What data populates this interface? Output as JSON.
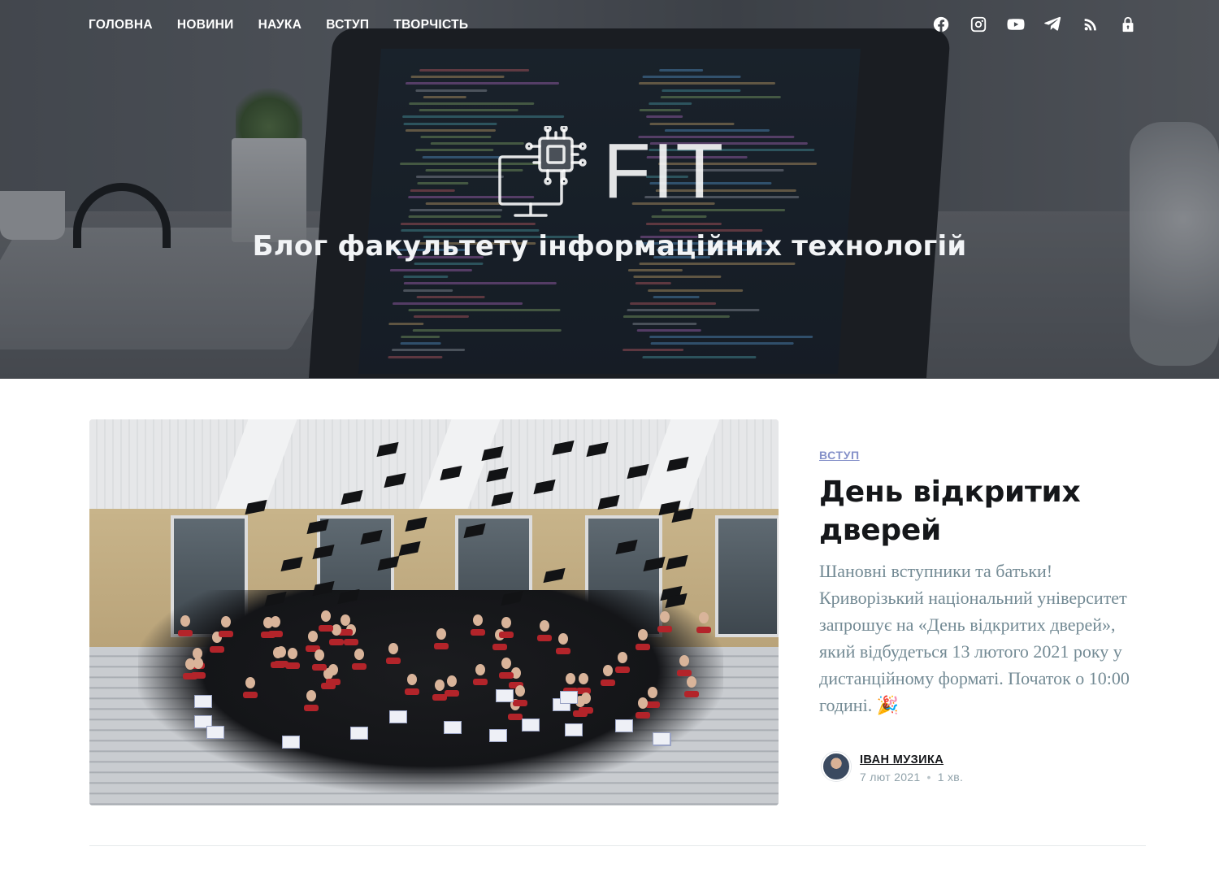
{
  "nav": {
    "items": [
      "Головна",
      "Новини",
      "Наука",
      "Вступ",
      "Творчість"
    ]
  },
  "social": [
    "facebook-icon",
    "instagram-icon",
    "youtube-icon",
    "telegram-icon",
    "rss-icon",
    "lock-icon"
  ],
  "hero": {
    "logo_text": "FIT",
    "tagline": "Блог факультету інформаційних технологій"
  },
  "post": {
    "tag": "Вступ",
    "title": "День відкритих дверей",
    "excerpt": "Шановні вступники та батьки! Криворізький національний університет запрошує на «День відкритих дверей», який відбудеться 13 лютого 2021 року у дистанційному форматі. Початок о 10:00 годині. 🎉",
    "author": "Іван Музика",
    "date": "7 лют 2021",
    "separator": "•",
    "reading_time": "1 хв."
  },
  "colors": {
    "accent": "#8591c9",
    "excerpt": "#738a94",
    "title": "#15171a"
  }
}
